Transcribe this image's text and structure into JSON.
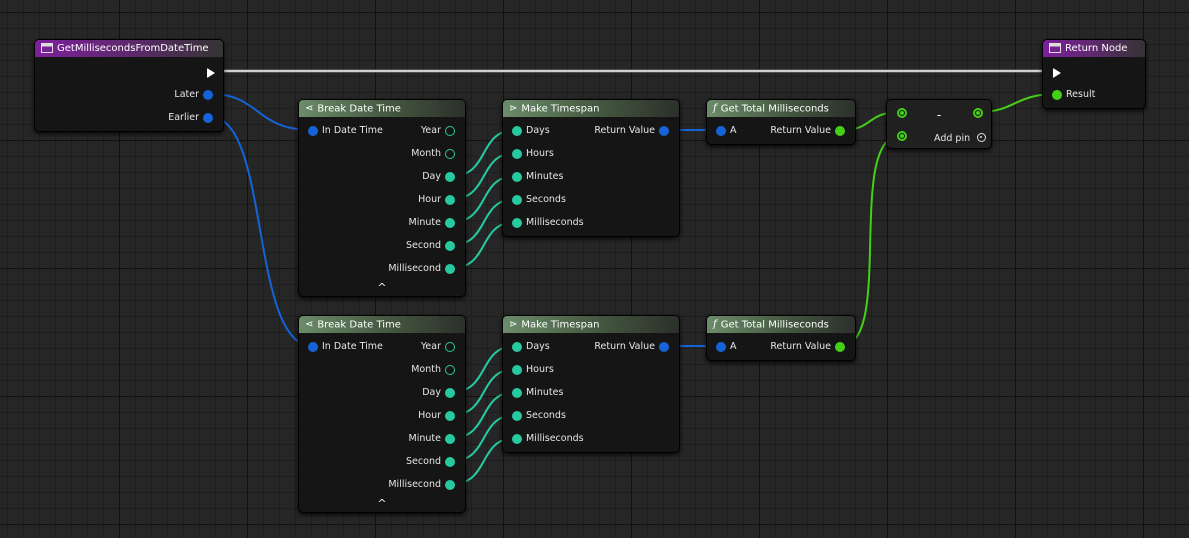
{
  "graph": {
    "wire_colors": {
      "exec": "#ffffff",
      "struct": "#1463d8",
      "int": "#27c9a0",
      "float": "#45d018"
    },
    "entry": {
      "title": "GetMillisecondsFromDateTime",
      "pins": {
        "later": "Later",
        "earlier": "Earlier"
      }
    },
    "return_node": {
      "title": "Return Node",
      "pins": {
        "result": "Result"
      }
    },
    "break_1": {
      "title": "Break Date Time",
      "input": "In Date Time",
      "outputs": [
        "Year",
        "Month",
        "Day",
        "Hour",
        "Minute",
        "Second",
        "Millisecond"
      ],
      "collapse": "^"
    },
    "break_2": {
      "title": "Break Date Time",
      "input": "In Date Time",
      "outputs": [
        "Year",
        "Month",
        "Day",
        "Hour",
        "Minute",
        "Second",
        "Millisecond"
      ],
      "collapse": "^"
    },
    "timespan_1": {
      "title": "Make Timespan",
      "inputs": [
        "Days",
        "Hours",
        "Minutes",
        "Seconds",
        "Milliseconds"
      ],
      "output": "Return Value"
    },
    "timespan_2": {
      "title": "Make Timespan",
      "inputs": [
        "Days",
        "Hours",
        "Minutes",
        "Seconds",
        "Milliseconds"
      ],
      "output": "Return Value"
    },
    "total_ms_1": {
      "title": "Get Total Milliseconds",
      "icon": "f",
      "input": "A",
      "output": "Return Value"
    },
    "total_ms_2": {
      "title": "Get Total Milliseconds",
      "icon": "f",
      "input": "A",
      "output": "Return Value"
    },
    "subtract": {
      "operator": "-",
      "add_pin": "Add pin"
    }
  }
}
